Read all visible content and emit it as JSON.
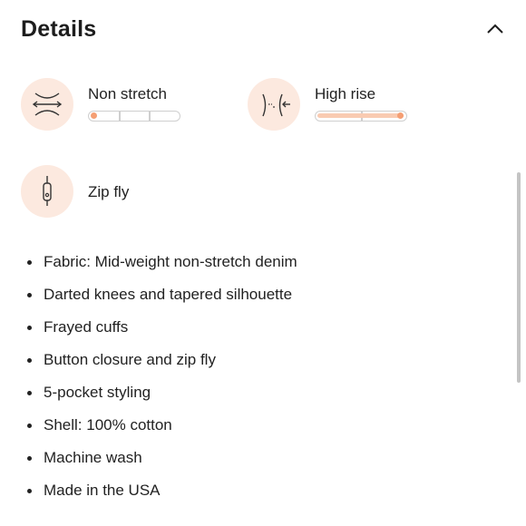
{
  "section": {
    "title": "Details",
    "collapse_icon": "chevron-up-icon"
  },
  "features": {
    "stretch": {
      "label": "Non stretch",
      "icon": "stretch-icon",
      "level": 0,
      "segments": 3
    },
    "rise": {
      "label": "High rise",
      "icon": "rise-icon",
      "level": 1.0,
      "segments": 2
    },
    "closure": {
      "label": "Zip fly",
      "icon": "zip-icon"
    }
  },
  "details_list": [
    "Fabric: Mid-weight non-stretch denim",
    "Darted knees and tapered silhouette",
    "Frayed cuffs",
    "Button closure and zip fly",
    "5-pocket styling",
    "Shell: 100% cotton",
    "Machine wash",
    "Made in the USA"
  ],
  "colors": {
    "accent": "#f59f74",
    "accent_light": "#f9cbb2",
    "icon_bg": "#fce9df"
  }
}
